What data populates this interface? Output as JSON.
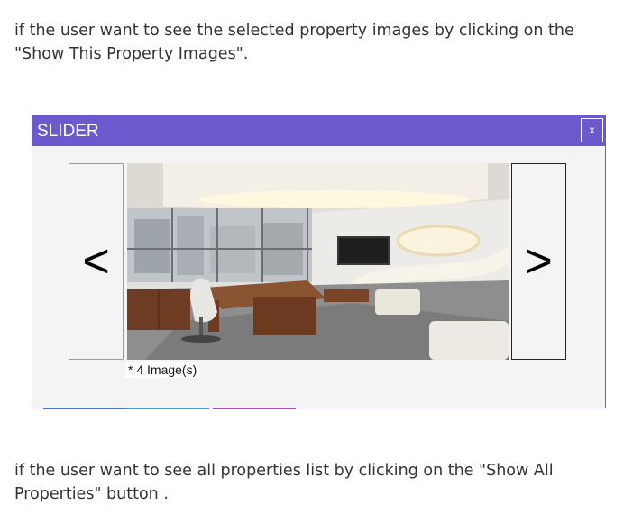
{
  "intro_text": "if the user want to see the selected property images by clicking on the \"Show This Property Images\".",
  "slider": {
    "title": "SLIDER",
    "close_label": "x",
    "prev_label": "<",
    "next_label": ">",
    "caption": "* 4 Image(s)"
  },
  "outro_text": "if the user want to see all properties list by clicking on the \"Show All Properties\" button .",
  "colors": {
    "accent": "#6a5acd",
    "text": "#333333",
    "modal_bg": "#f4f4f4"
  }
}
